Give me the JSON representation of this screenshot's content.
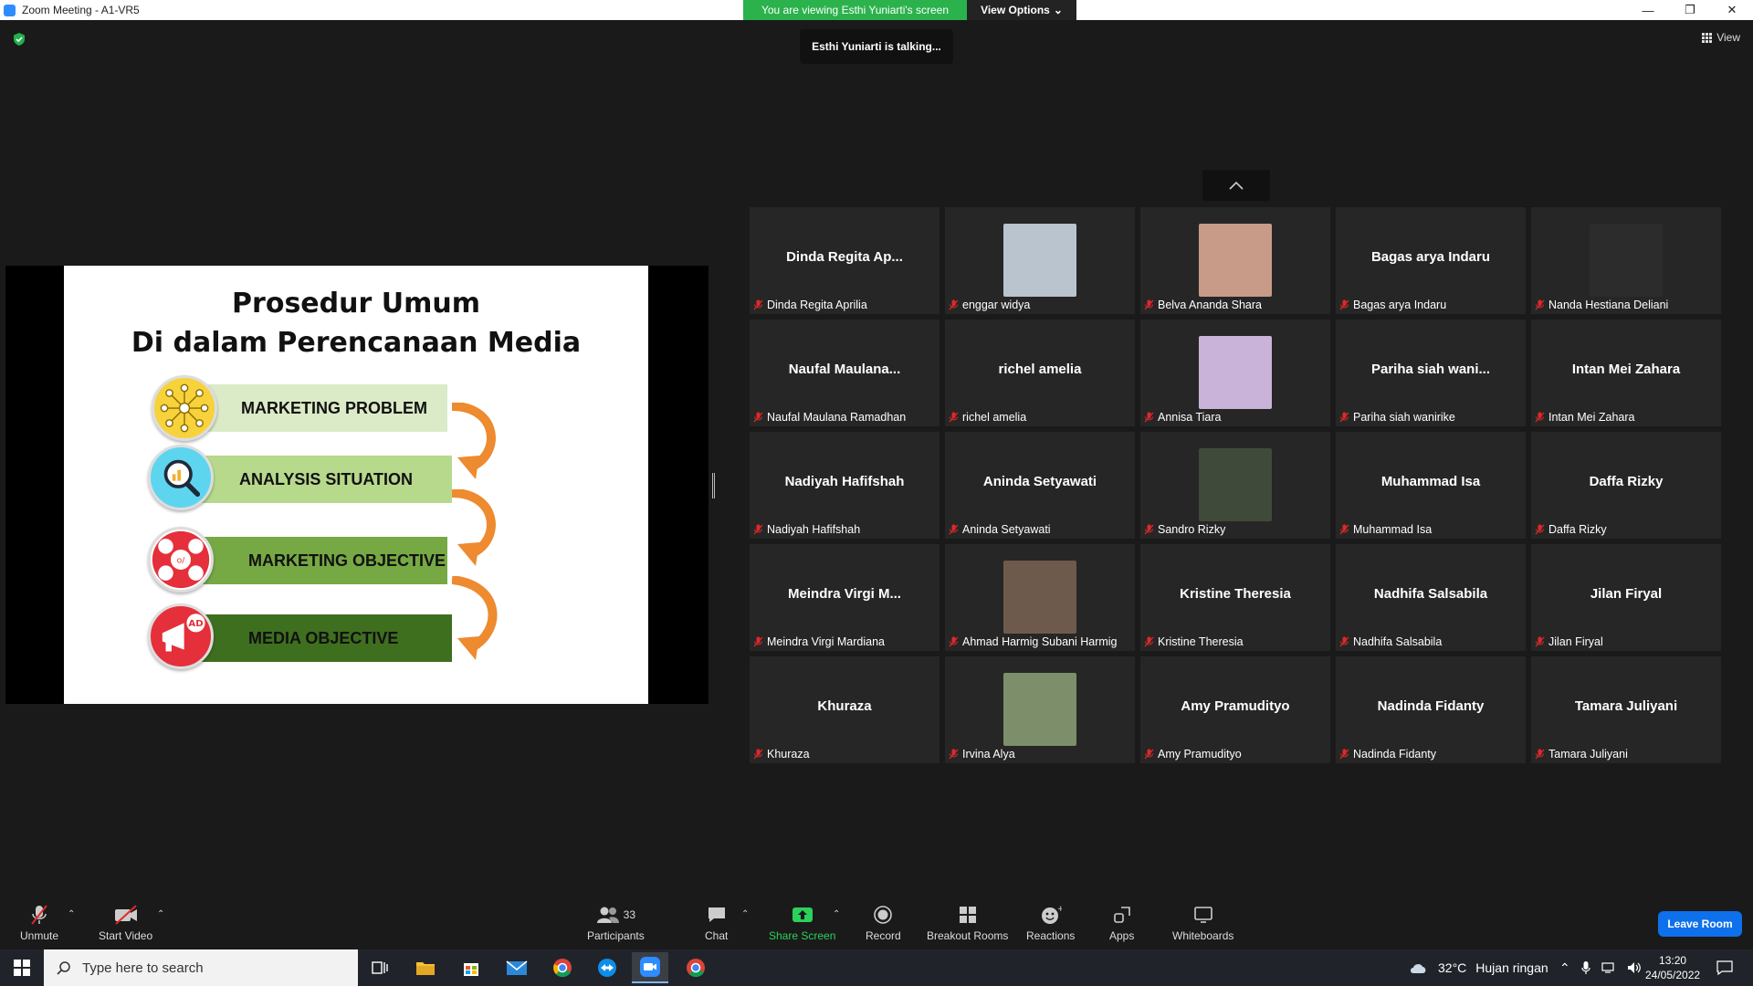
{
  "window": {
    "title": "Zoom Meeting - A1-VR5",
    "share_banner": "You are viewing Esthi Yuniarti's screen",
    "view_options": "View Options",
    "talking": "Esthi Yuniarti is talking...",
    "view": "View"
  },
  "slide": {
    "title_line1": "Prosedur Umum",
    "title_line2": "Di dalam Perencanaan Media",
    "steps": [
      "MARKETING PROBLEM",
      "ANALYSIS SITUATION",
      "MARKETING OBJECTIVE",
      "MEDIA OBJECTIVE"
    ],
    "ad_badge": "AD"
  },
  "participants": [
    {
      "big": "Dinda  Regita  Ap...",
      "name": "Dinda Regita Aprilia"
    },
    {
      "big": "",
      "name": "enggar widya",
      "photo": "#b9c4cf"
    },
    {
      "big": "",
      "name": "Belva Ananda Shara",
      "photo": "#c79b88"
    },
    {
      "big": "Bagas arya Indaru",
      "name": "Bagas arya Indaru"
    },
    {
      "big": "",
      "name": "Nanda Hestiana Deliani",
      "photo": "#2c2c2c"
    },
    {
      "big": "Naufal  Maulana...",
      "name": "Naufal Maulana Ramadhan"
    },
    {
      "big": "richel amelia",
      "name": "richel amelia"
    },
    {
      "big": "",
      "name": "Annisa Tiara",
      "photo": "#c9b3d9"
    },
    {
      "big": "Pariha  siah  wani...",
      "name": "Pariha siah wanirike"
    },
    {
      "big": "Intan Mei Zahara",
      "name": "Intan Mei Zahara"
    },
    {
      "big": "Nadiyah Hafifshah",
      "name": "Nadiyah Hafifshah"
    },
    {
      "big": "Aninda Setyawati",
      "name": "Aninda Setyawati"
    },
    {
      "big": "",
      "name": "Sandro Rizky",
      "photo": "#3f4a3a"
    },
    {
      "big": "Muhammad Isa",
      "name": "Muhammad Isa"
    },
    {
      "big": "Daffa Rizky",
      "name": "Daffa Rizky"
    },
    {
      "big": "Meindra  Virgi  M...",
      "name": "Meindra Virgi Mardiana"
    },
    {
      "big": "",
      "name": "Ahmad Harmig Subani Harmig",
      "photo": "#6e5a4d"
    },
    {
      "big": "Kristine Theresia",
      "name": "Kristine Theresia"
    },
    {
      "big": "Nadhifa Salsabila",
      "name": "Nadhifa Salsabila"
    },
    {
      "big": "Jilan Firyal",
      "name": "Jilan Firyal"
    },
    {
      "big": "Khuraza",
      "name": "Khuraza"
    },
    {
      "big": "",
      "name": "Irvina Alya",
      "photo": "#7c8f6a"
    },
    {
      "big": "Amy Pramudityo",
      "name": "Amy Pramudityo"
    },
    {
      "big": "Nadinda Fidanty",
      "name": "Nadinda Fidanty"
    },
    {
      "big": "Tamara Juliyani",
      "name": "Tamara Juliyani"
    }
  ],
  "toolbar": {
    "unmute": "Unmute",
    "start_video": "Start Video",
    "participants": "Participants",
    "participants_count": "33",
    "chat": "Chat",
    "share_screen": "Share Screen",
    "record": "Record",
    "breakout": "Breakout Rooms",
    "reactions": "Reactions",
    "apps": "Apps",
    "whiteboards": "Whiteboards",
    "leave": "Leave Room"
  },
  "taskbar": {
    "search_placeholder": "Type here to search",
    "temp": "32°C",
    "weather": "Hujan ringan",
    "time": "13:20",
    "date": "24/05/2022"
  },
  "colors": {
    "green_banner": "#2bb24c",
    "leave_blue": "#0e71eb",
    "mic_off_red": "#e02828"
  }
}
